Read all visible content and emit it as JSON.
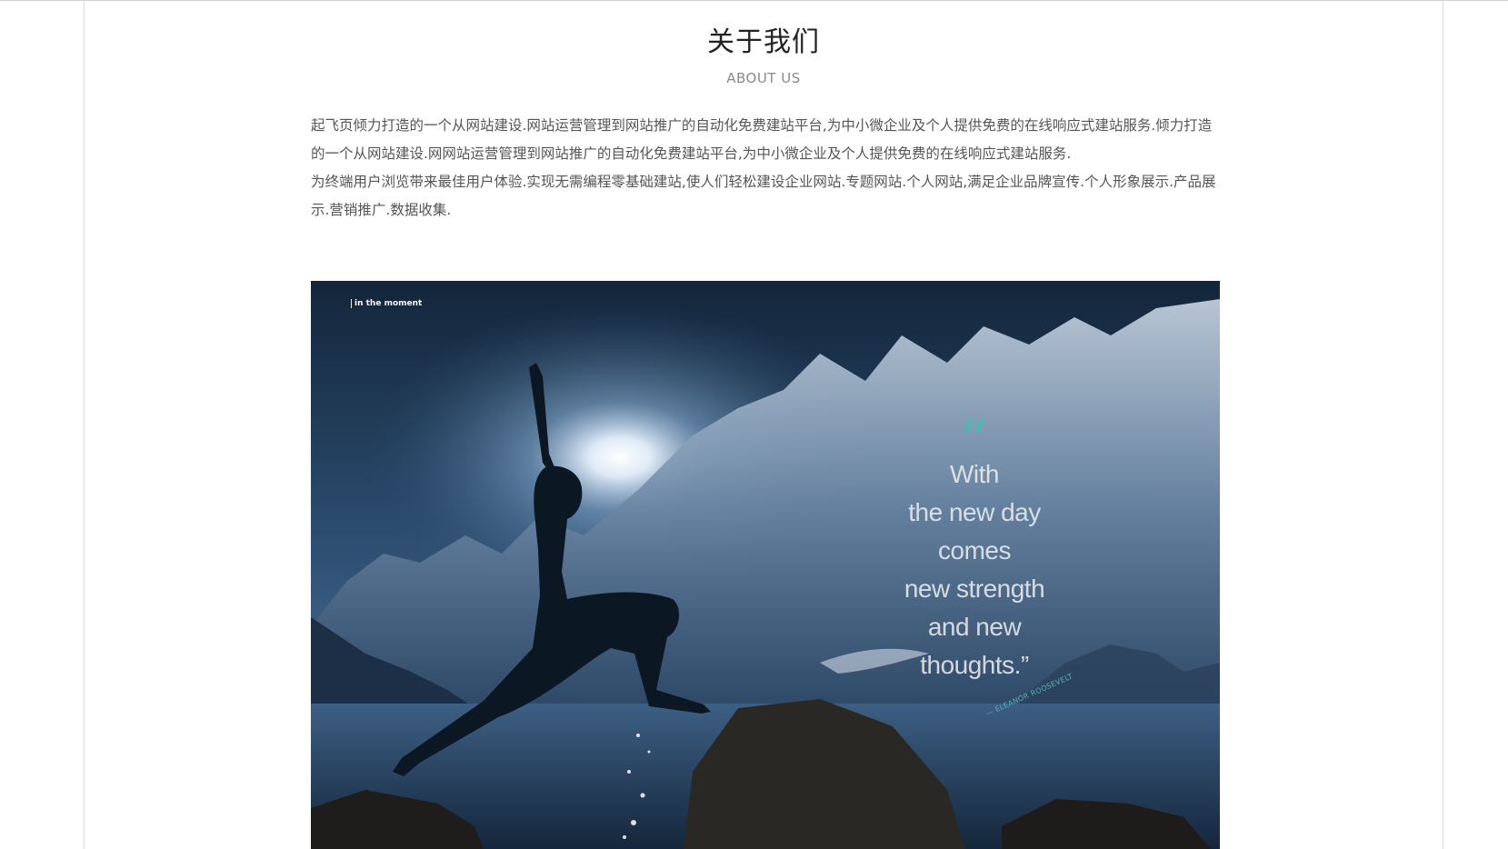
{
  "section": {
    "title": "关于我们",
    "subtitle": "ABOUT US"
  },
  "content": {
    "paragraph_1": "起飞页倾力打造的一个从网站建设.网站运营管理到网站推广的自动化免费建站平台,为中小微企业及个人提供免费的在线响应式建站服务.倾力打造的一个从网站建设.网网站运营管理到网站推广的自动化免费建站平台,为中小微企业及个人提供免费的在线响应式建站服务.",
    "paragraph_2": "为终端用户浏览带来最佳用户体验.实现无需编程零基础建站,使人们轻松建设企业网站.专题网站.个人网站,满足企业品牌宣传.个人形象展示.产品展示.营销推广.数据收集."
  },
  "photo": {
    "tagline": "in the moment",
    "quote_mark": "“",
    "quote_lines": [
      "With",
      "the new day",
      "comes",
      "new strength",
      "and new",
      "thoughts.”"
    ],
    "attribution": "— ELEANOR ROOSEVELT"
  },
  "colors": {
    "accent": "#58b2b5",
    "text": "#555555",
    "title": "#222222",
    "subtitle": "#8a8a8a"
  }
}
